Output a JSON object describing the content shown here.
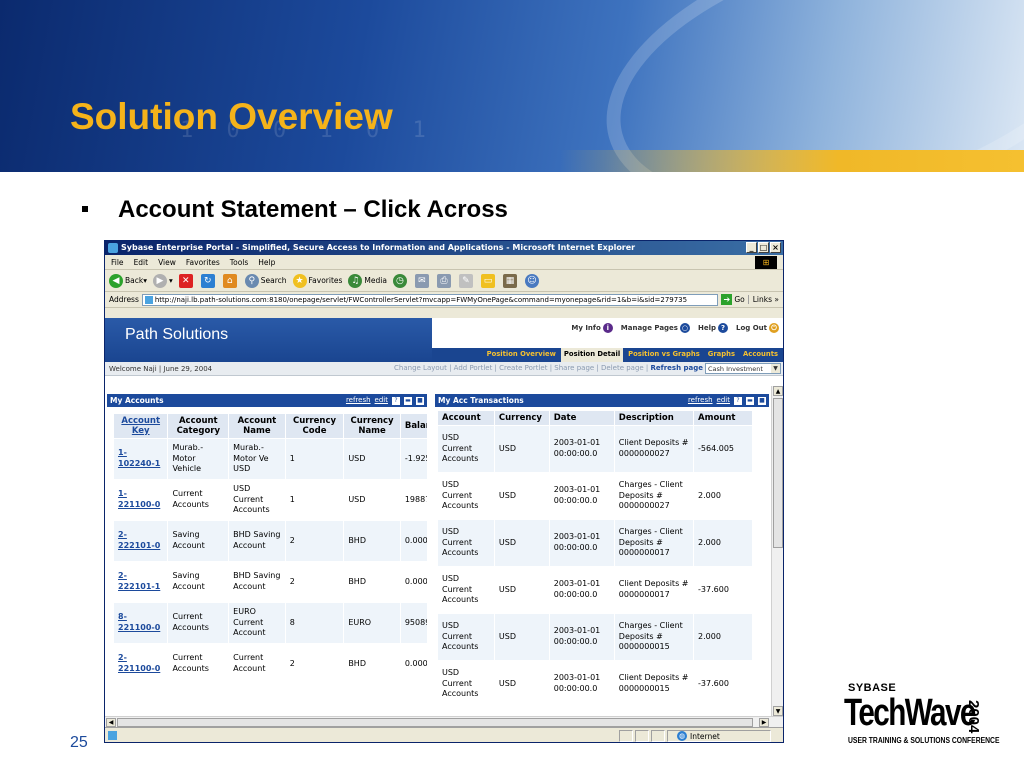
{
  "slide": {
    "title": "Solution Overview",
    "bullet": "Account Statement – Click Across",
    "page_number": "25",
    "banner_digits": "1 0 0 1 0 1"
  },
  "logo": {
    "brand": "SYBASE",
    "product": "TechWave",
    "year": "2004",
    "tagline": "USER TRAINING & SOLUTIONS CONFERENCE"
  },
  "browser": {
    "title": "Sybase Enterprise Portal - Simplified, Secure Access to Information and Applications - Microsoft Internet Explorer",
    "window_buttons": [
      "_",
      "□",
      "×"
    ],
    "menu": [
      "File",
      "Edit",
      "View",
      "Favorites",
      "Tools",
      "Help"
    ],
    "toolbar": {
      "back": "Back",
      "search": "Search",
      "favorites": "Favorites",
      "media": "Media"
    },
    "address_label": "Address",
    "address": "http://naji.lb.path-solutions.com:8180/onepage/servlet/FWControllerServlet?mvcapp=FWMyOnePage&command=myonepage&rid=1&b=i&sid=279735",
    "go": "Go",
    "links": "Links",
    "status_zone": "Internet"
  },
  "portal": {
    "name": "Path Solutions",
    "header_links": [
      "My Info",
      "Manage Pages",
      "Help",
      "Log Out"
    ],
    "tabs": [
      "Position Overview",
      "Position Detail",
      "Position vs Graphs",
      "Graphs",
      "Accounts"
    ],
    "active_tab": "Position Detail",
    "welcome": "Welcome Naji | June 29, 2004",
    "actions": "Change Layout | Add Portlet | Create Portlet | Share page | Delete page | ",
    "refresh_page": "Refresh page",
    "page_select": "Cash Investment"
  },
  "my_accounts": {
    "title": "My Accounts",
    "refresh": "refresh",
    "edit": "edit",
    "columns": [
      "Account Key",
      "Account Category",
      "Account Name",
      "Currency Code",
      "Currency Name",
      "Balan"
    ],
    "rows": [
      {
        "key": "1-102240-1",
        "category": "Murab.- Motor Vehicle",
        "name": "Murab.- Motor Ve USD",
        "code": "1",
        "currency": "USD",
        "balance": "-1.925"
      },
      {
        "key": "1-221100-0",
        "category": "Current Accounts",
        "name": "USD Current Accounts",
        "code": "1",
        "currency": "USD",
        "balance": "19887.:"
      },
      {
        "key": "2-222101-0",
        "category": "Saving Account",
        "name": "BHD Saving Account",
        "code": "2",
        "currency": "BHD",
        "balance": "0.000"
      },
      {
        "key": "2-222101-1",
        "category": "Saving Account",
        "name": "BHD Saving Account",
        "code": "2",
        "currency": "BHD",
        "balance": "0.000"
      },
      {
        "key": "8-221100-0",
        "category": "Current Accounts",
        "name": "EURO Current Account",
        "code": "8",
        "currency": "EURO",
        "balance": "95089.!"
      },
      {
        "key": "2-221100-0",
        "category": "Current Accounts",
        "name": "Current Account",
        "code": "2",
        "currency": "BHD",
        "balance": "0.000"
      }
    ]
  },
  "transactions": {
    "title": "My Acc Transactions",
    "refresh": "refresh",
    "edit": "edit",
    "columns": [
      "Account",
      "Currency",
      "Date",
      "Description",
      "Amount"
    ],
    "rows": [
      {
        "account": "USD Current Accounts",
        "currency": "USD",
        "date": "2003-01-01 00:00:00.0",
        "description": "Client Deposits # 0000000027",
        "amount": "-564.005"
      },
      {
        "account": "USD Current Accounts",
        "currency": "USD",
        "date": "2003-01-01 00:00:00.0",
        "description": "Charges - Client Deposits # 0000000027",
        "amount": "2.000"
      },
      {
        "account": "USD Current Accounts",
        "currency": "USD",
        "date": "2003-01-01 00:00:00.0",
        "description": "Charges - Client Deposits # 0000000017",
        "amount": "2.000"
      },
      {
        "account": "USD Current Accounts",
        "currency": "USD",
        "date": "2003-01-01 00:00:00.0",
        "description": "Client Deposits # 0000000017",
        "amount": "-37.600"
      },
      {
        "account": "USD Current Accounts",
        "currency": "USD",
        "date": "2003-01-01 00:00:00.0",
        "description": "Charges - Client Deposits # 0000000015",
        "amount": "2.000"
      },
      {
        "account": "USD Current Accounts",
        "currency": "USD",
        "date": "2003-01-01 00:00:00.0",
        "description": "Client Deposits # 0000000015",
        "amount": "-37.600"
      }
    ]
  },
  "colors": {
    "title_gold": "#f5b31a",
    "portal_blue": "#1c4a9c",
    "row_alt": "#eef4fa"
  }
}
